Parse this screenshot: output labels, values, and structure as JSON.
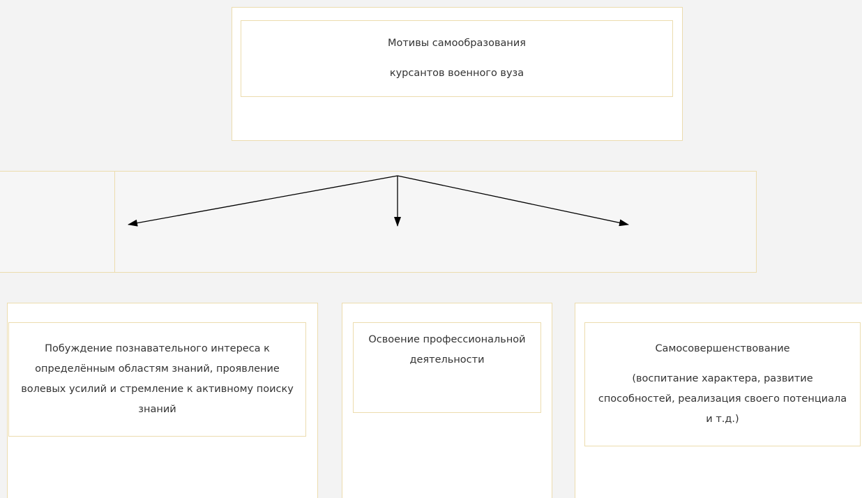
{
  "diagram": {
    "root": {
      "line1": "Мотивы самообразования",
      "line2": "курсантов военного вуза"
    },
    "branches": [
      {
        "text": "Побуждение познавательного интереса к определённым областям знаний, проявление волевых усилий и стремление к активному поиску знаний"
      },
      {
        "text": "Освоение профессиональной деятельности"
      },
      {
        "title": "Самосовершенствование",
        "text": "(воспитание характера, развитие способностей, реализация своего потенциала и т.д.)"
      }
    ]
  },
  "colors": {
    "page_background": "#f3f3f3",
    "cell_border": "#ecdcae",
    "box_background": "#ffffff",
    "arrow": "#000000",
    "text": "#333333"
  }
}
